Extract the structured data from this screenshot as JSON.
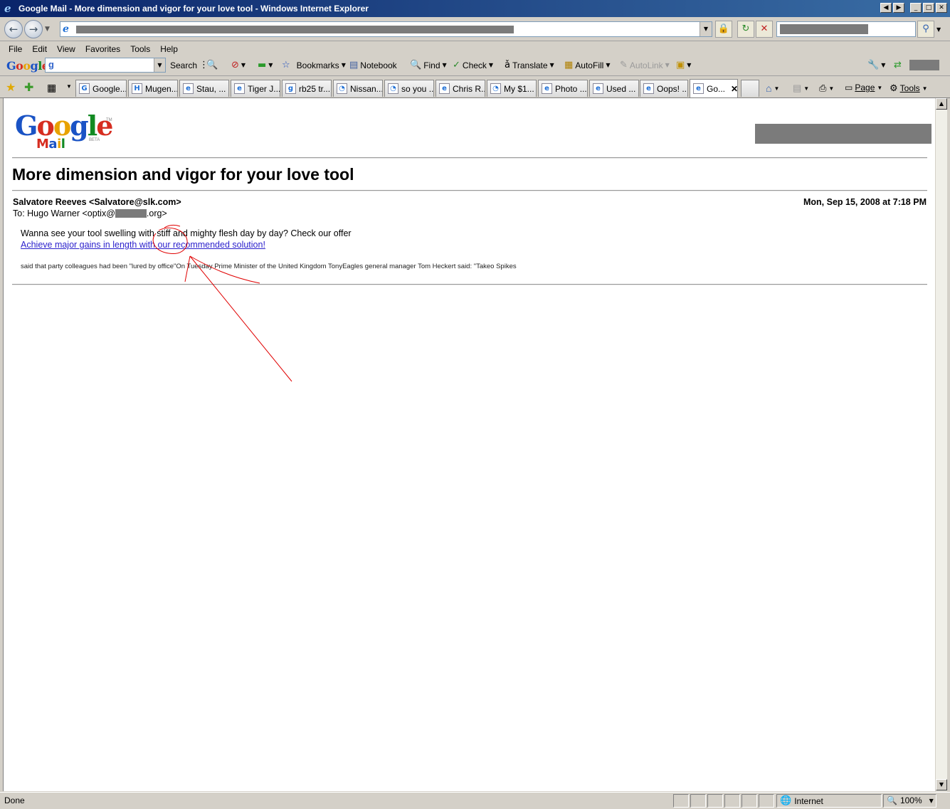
{
  "window": {
    "title": "Google Mail - More dimension and vigor for your love tool - Windows Internet Explorer"
  },
  "menu": [
    "File",
    "Edit",
    "View",
    "Favorites",
    "Tools",
    "Help"
  ],
  "google_toolbar": {
    "logo": "Google",
    "search_label": "Search",
    "bookmarks": "Bookmarks",
    "notebook": "Notebook",
    "find": "Find",
    "check": "Check",
    "translate": "Translate",
    "autofill": "AutoFill",
    "autolink": "AutoLink"
  },
  "tabs": [
    "Google...",
    "Mugen...",
    "Stau, ...",
    "Tiger J...",
    "rb25 tr...",
    "Nissan...",
    "so you ...",
    "Chris R...",
    "My $1...",
    "Photo ...",
    "Used ...",
    "Oops! ...",
    "Go..."
  ],
  "tab_tools": {
    "page": "Page",
    "tools": "Tools"
  },
  "email": {
    "logo_word": "Google",
    "logo_mail": "Mail",
    "logo_beta": "BETA",
    "logo_tm": "TM",
    "subject": "More dimension and vigor for your love tool",
    "from": "Salvatore Reeves <Salvatore@slk.com>",
    "date": "Mon, Sep 15, 2008 at 7:18 PM",
    "to_prefix": "To: Hugo Warner <optix@",
    "to_suffix": ".org>",
    "body_line": "Wanna see your tool swelling with stiff and mighty flesh day by day? Check our offer",
    "link_text": "Achieve major gains in length with our recommended solution!",
    "small_text": "said that party colleagues had been \"lured by office\"On Tuesday Prime Minister of the United Kingdom TonyEagles general manager Tom Heckert said: \"Takeo Spikes"
  },
  "status": {
    "left": "Done",
    "zone": "Internet",
    "zoom": "100%"
  },
  "colors": {
    "titlebar": "#0a246a",
    "link": "#2a1fcc",
    "annotation": "#e00000"
  }
}
